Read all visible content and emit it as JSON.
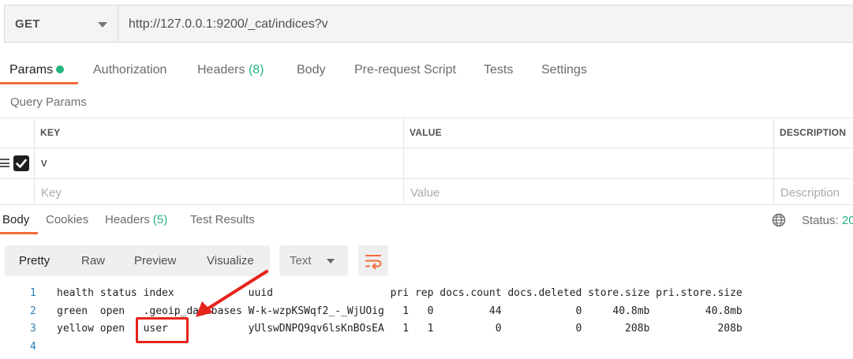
{
  "request": {
    "method": "GET",
    "url": "http://127.0.0.1:9200/_cat/indices?v"
  },
  "request_tabs": {
    "params": "Params",
    "authorization": "Authorization",
    "headers": "Headers",
    "headers_count": "(8)",
    "body": "Body",
    "prerequest": "Pre-request Script",
    "tests": "Tests",
    "settings": "Settings"
  },
  "query_params": {
    "title": "Query Params",
    "headers": {
      "key": "KEY",
      "value": "VALUE",
      "description": "DESCRIPTION"
    },
    "row": {
      "key": "v",
      "value": "",
      "description": "",
      "checked": true
    },
    "placeholders": {
      "key": "Key",
      "value": "Value",
      "description": "Description"
    }
  },
  "response_tabs": {
    "body": "Body",
    "cookies": "Cookies",
    "headers": "Headers",
    "headers_count": "(5)",
    "test_results": "Test Results",
    "status_label": "Status:",
    "status_value": "20"
  },
  "view_options": {
    "pretty": "Pretty",
    "raw": "Raw",
    "preview": "Preview",
    "visualize": "Visualize",
    "format": "Text"
  },
  "response_body": {
    "line_numbers": [
      "1",
      "2",
      "3",
      "4"
    ],
    "lines": [
      "health status index            uuid                   pri rep docs.count docs.deleted store.size pri.store.size",
      "green  open   .geoip_databases W-k-wzpKSWqf2_-_WjUOig   1   0         44            0     40.8mb         40.8mb",
      "yellow open   user             yUlswDNPQ9qv6lsKnBOsEA   1   1          0            0       208b           208b",
      ""
    ]
  },
  "colors": {
    "accent": "#f26b3a",
    "success": "#26b47f",
    "annotation": "#e5241d"
  }
}
